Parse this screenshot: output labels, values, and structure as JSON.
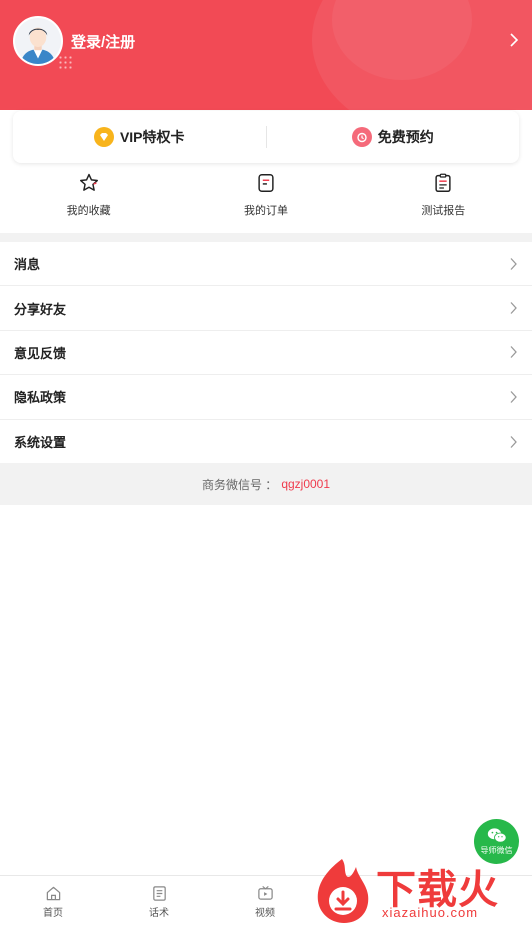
{
  "header": {
    "login_label": "登录/注册",
    "bg_color": "#f24a55"
  },
  "promo": {
    "vip_label": "VIP特权卡",
    "vip_icon": "diamond-icon",
    "booking_label": "免费预约",
    "booking_icon": "alarm-clock-icon"
  },
  "quick_actions": [
    {
      "label": "我的收藏",
      "icon": "star-icon"
    },
    {
      "label": "我的订单",
      "icon": "order-icon"
    },
    {
      "label": "测试报告",
      "icon": "clipboard-icon"
    }
  ],
  "menu": [
    {
      "label": "消息"
    },
    {
      "label": "分享好友"
    },
    {
      "label": "意见反馈"
    },
    {
      "label": "隐私政策"
    },
    {
      "label": "系统设置"
    }
  ],
  "contact": {
    "label": "商务微信号 ：",
    "value": "qgzj0001",
    "accent": "#ef3b4d"
  },
  "floating_button": {
    "label": "导师微信",
    "icon": "wechat-icon",
    "color": "#27b84a"
  },
  "tabbar": [
    {
      "label": "首页",
      "icon": "home-icon"
    },
    {
      "label": "话术",
      "icon": "script-icon"
    },
    {
      "label": "视频",
      "icon": "video-icon"
    }
  ],
  "watermark": {
    "text": "下载火",
    "url": "xiazaihuo.com"
  }
}
